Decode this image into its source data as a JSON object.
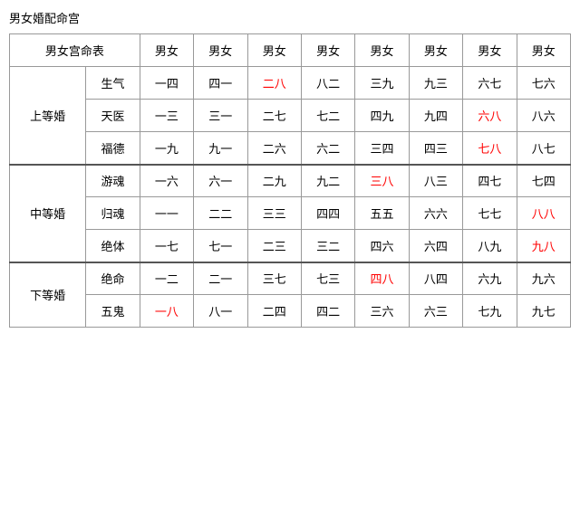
{
  "title": "男女婚配命宫",
  "table": {
    "header": {
      "col0": "男女宫命表",
      "cols": [
        "男女",
        "男女",
        "男女",
        "男女",
        "男女",
        "男女",
        "男女",
        "男女"
      ]
    },
    "sections": [
      {
        "section_label": "上等婚",
        "rows": [
          {
            "row_label": "生气",
            "cells": [
              {
                "text": "一四",
                "red": false
              },
              {
                "text": "四一",
                "red": false
              },
              {
                "text": "二八",
                "red": true
              },
              {
                "text": "八二",
                "red": false
              },
              {
                "text": "三九",
                "red": false
              },
              {
                "text": "九三",
                "red": false
              },
              {
                "text": "六七",
                "red": false
              },
              {
                "text": "七六",
                "red": false
              }
            ]
          },
          {
            "row_label": "天医",
            "cells": [
              {
                "text": "一三",
                "red": false
              },
              {
                "text": "三一",
                "red": false
              },
              {
                "text": "二七",
                "red": false
              },
              {
                "text": "七二",
                "red": false
              },
              {
                "text": "四九",
                "red": false
              },
              {
                "text": "九四",
                "red": false
              },
              {
                "text": "六八",
                "red": true
              },
              {
                "text": "八六",
                "red": false
              }
            ]
          },
          {
            "row_label": "福德",
            "cells": [
              {
                "text": "一九",
                "red": false
              },
              {
                "text": "九一",
                "red": false
              },
              {
                "text": "二六",
                "red": false
              },
              {
                "text": "六二",
                "red": false
              },
              {
                "text": "三四",
                "red": false
              },
              {
                "text": "四三",
                "red": false
              },
              {
                "text": "七八",
                "red": true
              },
              {
                "text": "八七",
                "red": false
              }
            ]
          }
        ]
      },
      {
        "section_label": "中等婚",
        "rows": [
          {
            "row_label": "游魂",
            "cells": [
              {
                "text": "一六",
                "red": false
              },
              {
                "text": "六一",
                "red": false
              },
              {
                "text": "二九",
                "red": false
              },
              {
                "text": "九二",
                "red": false
              },
              {
                "text": "三八",
                "red": true
              },
              {
                "text": "八三",
                "red": false
              },
              {
                "text": "四七",
                "red": false
              },
              {
                "text": "七四",
                "red": false
              }
            ]
          },
          {
            "row_label": "归魂",
            "cells": [
              {
                "text": "一一",
                "red": false
              },
              {
                "text": "二二",
                "red": false
              },
              {
                "text": "三三",
                "red": false
              },
              {
                "text": "四四",
                "red": false
              },
              {
                "text": "五五",
                "red": false
              },
              {
                "text": "六六",
                "red": false
              },
              {
                "text": "七七",
                "red": false
              },
              {
                "text": "八八",
                "red": true
              }
            ]
          },
          {
            "row_label": "绝体",
            "cells": [
              {
                "text": "一七",
                "red": false
              },
              {
                "text": "七一",
                "red": false
              },
              {
                "text": "二三",
                "red": false
              },
              {
                "text": "三二",
                "red": false
              },
              {
                "text": "四六",
                "red": false
              },
              {
                "text": "六四",
                "red": false
              },
              {
                "text": "八九",
                "red": false
              },
              {
                "text": "九八",
                "red": true
              }
            ]
          }
        ]
      },
      {
        "section_label": "下等婚",
        "rows": [
          {
            "row_label": "绝命",
            "cells": [
              {
                "text": "一二",
                "red": false
              },
              {
                "text": "二一",
                "red": false
              },
              {
                "text": "三七",
                "red": false
              },
              {
                "text": "七三",
                "red": false
              },
              {
                "text": "四八",
                "red": true
              },
              {
                "text": "八四",
                "red": false
              },
              {
                "text": "六九",
                "red": false
              },
              {
                "text": "九六",
                "red": false
              }
            ]
          },
          {
            "row_label": "五鬼",
            "cells": [
              {
                "text": "一八",
                "red": true
              },
              {
                "text": "八一",
                "red": false
              },
              {
                "text": "二四",
                "red": false
              },
              {
                "text": "四二",
                "red": false
              },
              {
                "text": "三六",
                "red": false
              },
              {
                "text": "六三",
                "red": false
              },
              {
                "text": "七九",
                "red": false
              },
              {
                "text": "九七",
                "red": false
              }
            ]
          }
        ]
      }
    ]
  }
}
